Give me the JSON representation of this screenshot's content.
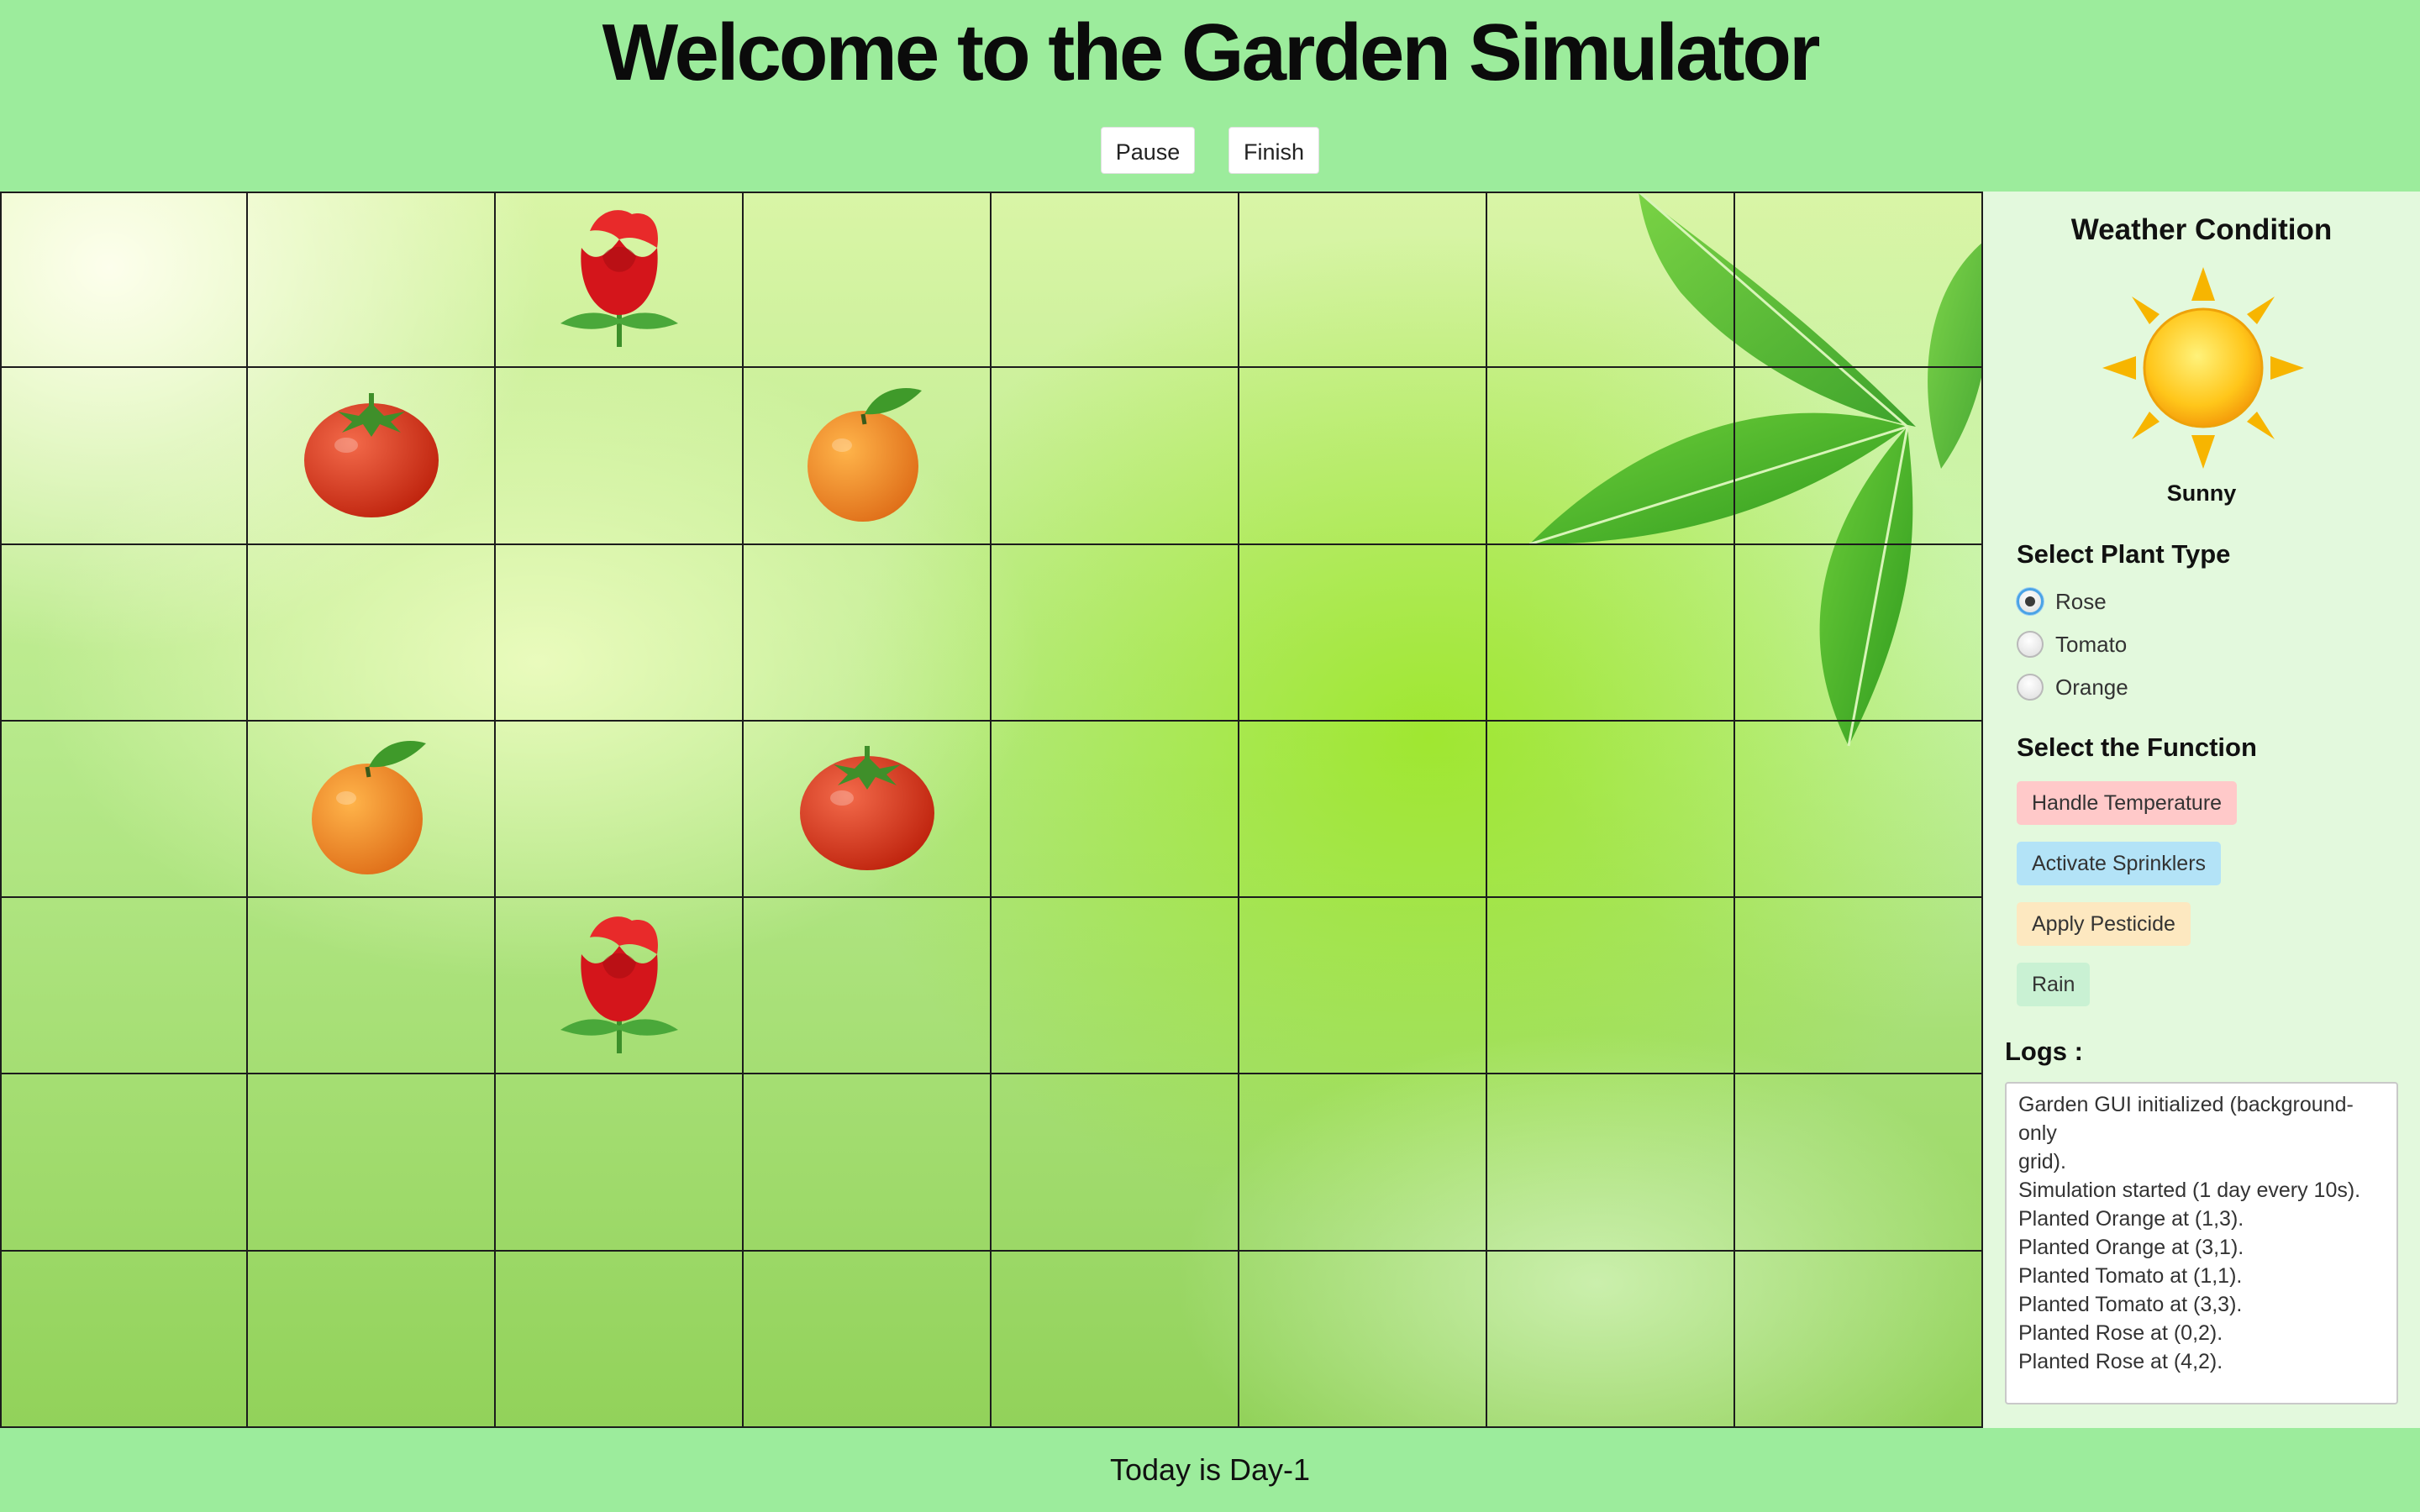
{
  "header": {
    "title": "Welcome to the Garden Simulator",
    "pause_label": "Pause",
    "finish_label": "Finish"
  },
  "garden": {
    "rows": 7,
    "cols": 8,
    "plants": [
      {
        "type": "rose",
        "row": 0,
        "col": 2
      },
      {
        "type": "tomato",
        "row": 1,
        "col": 1
      },
      {
        "type": "orange",
        "row": 1,
        "col": 3
      },
      {
        "type": "orange",
        "row": 3,
        "col": 1
      },
      {
        "type": "tomato",
        "row": 3,
        "col": 3
      },
      {
        "type": "rose",
        "row": 4,
        "col": 2
      }
    ]
  },
  "sidebar": {
    "weather_title": "Weather Condition",
    "weather_icon": "sun-icon",
    "weather_label": "Sunny",
    "plant_type_title": "Select Plant Type",
    "plant_types": [
      {
        "label": "Rose",
        "checked": true
      },
      {
        "label": "Tomato",
        "checked": false
      },
      {
        "label": "Orange",
        "checked": false
      }
    ],
    "function_title": "Select the Function",
    "functions": [
      {
        "label": "Handle Temperature",
        "color": "#ffc9c9"
      },
      {
        "label": "Activate Sprinklers",
        "color": "#b3e3f7"
      },
      {
        "label": "Apply Pesticide",
        "color": "#fde8c0"
      },
      {
        "label": "Rain",
        "color": "#c9f1d3"
      }
    ],
    "logs_title": "Logs :",
    "logs": [
      "Garden GUI initialized (background-only",
      "grid).",
      "Simulation started (1 day every 10s).",
      "Planted Orange at (1,3).",
      "Planted Orange at (3,1).",
      "Planted Tomato at (1,1).",
      "Planted Tomato at (3,3).",
      "Planted Rose at (0,2).",
      "Planted Rose at (4,2)."
    ]
  },
  "footer": {
    "day_text": "Today is Day-1"
  },
  "colors": {
    "header_bg": "#9cec9c",
    "sidebar_bg": "#e3f9dd",
    "grid_line": "#1c1c1c"
  }
}
